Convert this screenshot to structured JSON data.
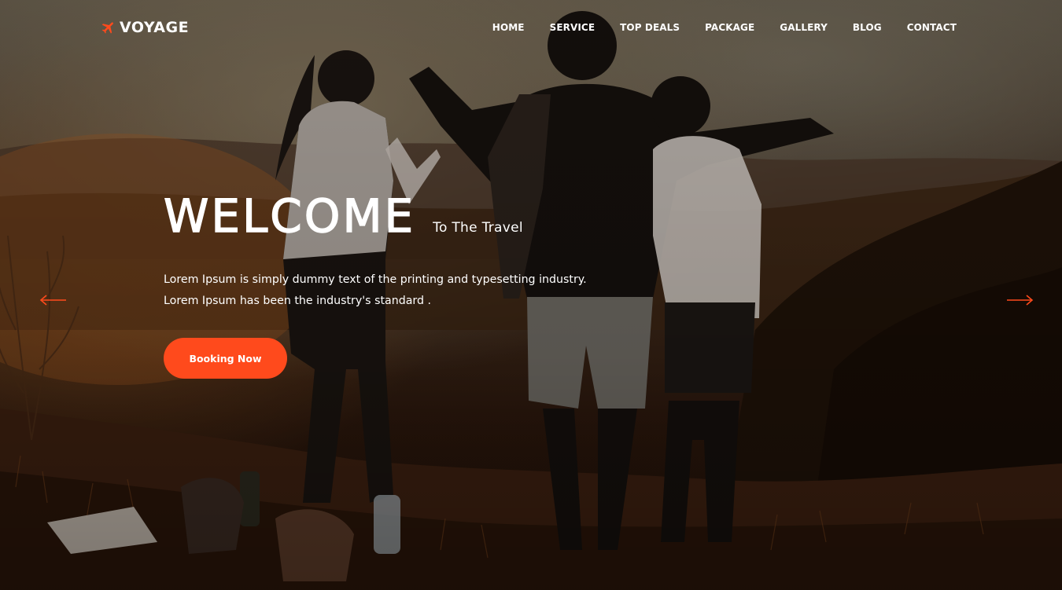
{
  "brand": {
    "name": "VOYAGE",
    "icon": "airplane-icon",
    "accent_color": "#ff4a1c"
  },
  "nav": {
    "items": [
      {
        "label": "HOME"
      },
      {
        "label": "SERVICE"
      },
      {
        "label": "TOP DEALS"
      },
      {
        "label": "PACKAGE"
      },
      {
        "label": "GALLERY"
      },
      {
        "label": "BLOG"
      },
      {
        "label": "CONTACT"
      }
    ]
  },
  "hero": {
    "title": "WELCOME",
    "subtitle": "To The Travel",
    "description_line1": "Lorem Ipsum is simply dummy text of the printing and typesetting industry.",
    "description_line2": "Lorem Ipsum has been the industry's standard .",
    "cta_label": "Booking Now",
    "prev_icon": "arrow-left-icon",
    "next_icon": "arrow-right-icon"
  }
}
